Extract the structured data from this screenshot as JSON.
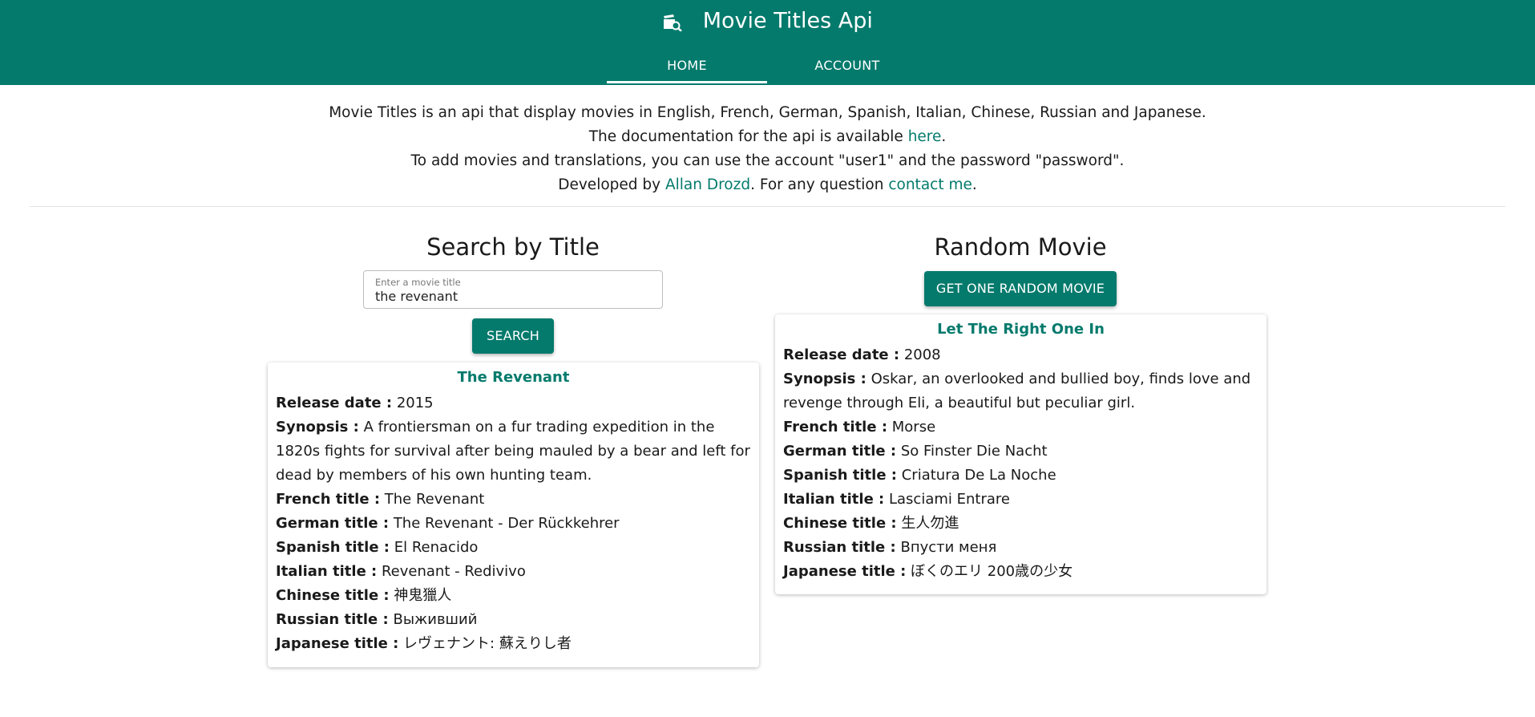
{
  "app": {
    "title": "Movie Titles Api",
    "icon": "movie-search-icon"
  },
  "nav": {
    "tabs": [
      {
        "label": "HOME",
        "active": true
      },
      {
        "label": "ACCOUNT",
        "active": false
      }
    ]
  },
  "intro": {
    "line1": "Movie Titles is an api that display movies in English, French, German, Spanish, Italian, Chinese, Russian and Japanese.",
    "line2_pre": "The documentation for the api is available ",
    "line2_link": "here",
    "line2_post": ".",
    "line3": "To add movies and translations, you can use the account \"user1\" and the password \"password\".",
    "line4_pre": "Developed by ",
    "line4_link1": "Allan Drozd",
    "line4_mid": ". For any question ",
    "line4_link2": "contact me",
    "line4_post": "."
  },
  "search": {
    "title": "Search by Title",
    "placeholder": "Enter a movie title",
    "value": "the revenant",
    "button": "SEARCH",
    "result": {
      "title": "The Revenant",
      "fields": [
        {
          "label": "Release date :",
          "value": "2015"
        },
        {
          "label": "Synopsis :",
          "value": "A frontiersman on a fur trading expedition in the 1820s fights for survival after being mauled by a bear and left for dead by members of his own hunting team."
        },
        {
          "label": "French title :",
          "value": "The Revenant"
        },
        {
          "label": "German title :",
          "value": "The Revenant - Der Rückkehrer"
        },
        {
          "label": "Spanish title :",
          "value": "El Renacido"
        },
        {
          "label": "Italian title :",
          "value": "Revenant - Redivivo"
        },
        {
          "label": "Chinese title :",
          "value": "神鬼獵人"
        },
        {
          "label": "Russian title :",
          "value": "Выживший"
        },
        {
          "label": "Japanese title :",
          "value": "レヴェナント: 蘇えりし者"
        }
      ]
    }
  },
  "random": {
    "title": "Random Movie",
    "button": "GET ONE RANDOM MOVIE",
    "result": {
      "title": "Let The Right One In",
      "fields": [
        {
          "label": "Release date :",
          "value": "2008"
        },
        {
          "label": "Synopsis :",
          "value": "Oskar, an overlooked and bullied boy, finds love and revenge through Eli, a beautiful but peculiar girl."
        },
        {
          "label": "French title :",
          "value": "Morse"
        },
        {
          "label": "German title :",
          "value": "So Finster Die Nacht"
        },
        {
          "label": "Spanish title :",
          "value": "Criatura De La Noche"
        },
        {
          "label": "Italian title :",
          "value": "Lasciami Entrare"
        },
        {
          "label": "Chinese title :",
          "value": "生人勿進"
        },
        {
          "label": "Russian title :",
          "value": "Впусти меня"
        },
        {
          "label": "Japanese title :",
          "value": "ぼくのエリ 200歳の少女"
        }
      ]
    }
  },
  "colors": {
    "primary": "#047a6c",
    "link": "#047a6c",
    "text": "#1a1a1a"
  }
}
